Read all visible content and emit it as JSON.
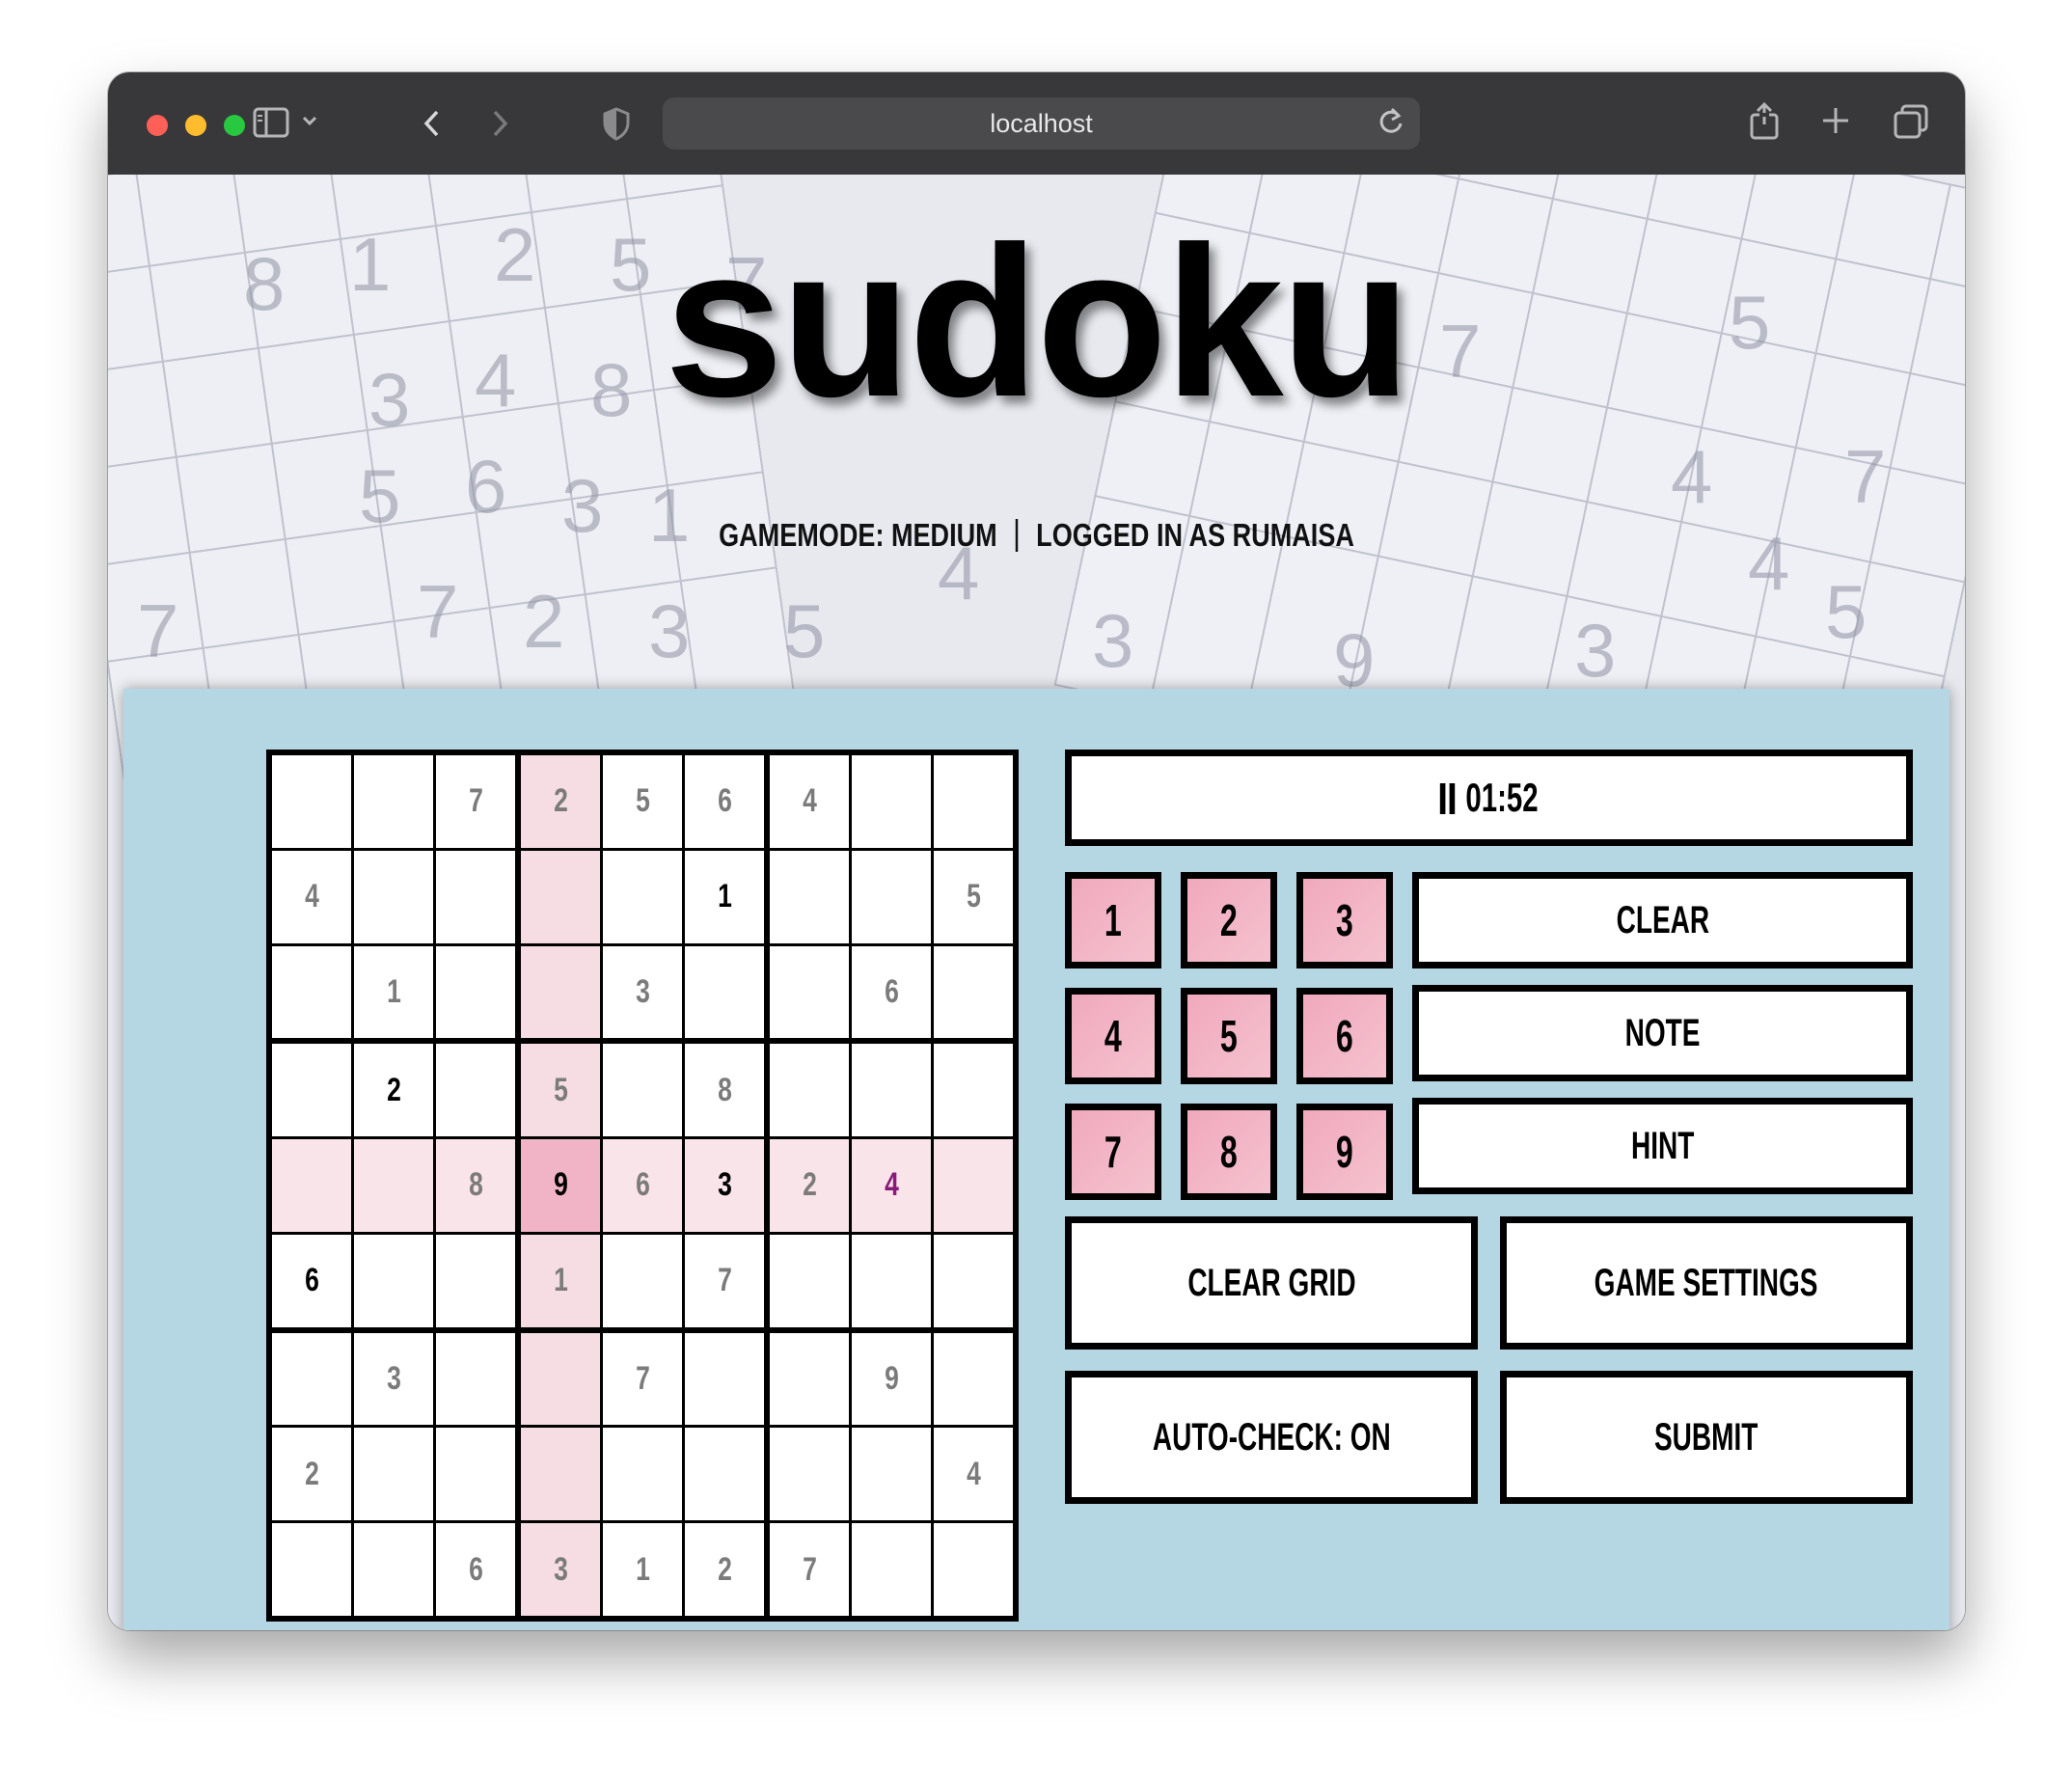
{
  "browser": {
    "url": "localhost",
    "icons": {
      "sidebar": "sidebar-icon",
      "back": "chevron-left-icon",
      "forward": "chevron-right-icon",
      "shield": "shield-icon",
      "reload": "reload-icon",
      "share": "share-icon",
      "new_tab": "plus-icon",
      "tabs": "tabs-overview-icon"
    }
  },
  "header": {
    "title": "sudoku",
    "gamemode": "GAMEMODE: MEDIUM",
    "logged_in": "LOGGED IN AS RUMAISA"
  },
  "timer": {
    "time": "01:52",
    "icon": "pause-icon"
  },
  "numpad": [
    "1",
    "2",
    "3",
    "4",
    "5",
    "6",
    "7",
    "8",
    "9"
  ],
  "actions": {
    "clear": "CLEAR",
    "note": "NOTE",
    "hint": "HINT",
    "clear_grid": "CLEAR GRID",
    "game_settings": "GAME SETTINGS",
    "auto_check": "AUTO-CHECK: ON",
    "submit": "SUBMIT"
  },
  "board": {
    "rows": [
      [
        "",
        "",
        "7",
        "2",
        "5",
        "6",
        "4",
        "",
        ""
      ],
      [
        "4",
        "",
        "",
        "",
        "",
        "1",
        "",
        "",
        "5"
      ],
      [
        "",
        "1",
        "",
        "",
        "3",
        "",
        "",
        "6",
        ""
      ],
      [
        "",
        "2",
        "",
        "5",
        "",
        "8",
        "",
        "",
        ""
      ],
      [
        "",
        "",
        "8",
        "9",
        "6",
        "3",
        "2",
        "4",
        ""
      ],
      [
        "6",
        "",
        "",
        "1",
        "",
        "7",
        "",
        "",
        ""
      ],
      [
        "",
        "3",
        "",
        "",
        "7",
        "",
        "",
        "9",
        ""
      ],
      [
        "2",
        "",
        "",
        "",
        "",
        "",
        "",
        "",
        "4"
      ],
      [
        "",
        "",
        "6",
        "3",
        "1",
        "2",
        "7",
        "",
        ""
      ]
    ],
    "given": [
      [
        1,
        5
      ],
      [
        3,
        1
      ],
      [
        4,
        3
      ],
      [
        4,
        5
      ],
      [
        5,
        0
      ],
      [
        4,
        3
      ]
    ],
    "user_entered": [
      [
        4,
        7
      ]
    ],
    "selected": [
      4,
      3
    ],
    "colors": {
      "highlight": "#f9e4ea",
      "selected": "#f0b4c6",
      "panel": "#b5d7e3",
      "user": "#8a1a7a"
    }
  }
}
